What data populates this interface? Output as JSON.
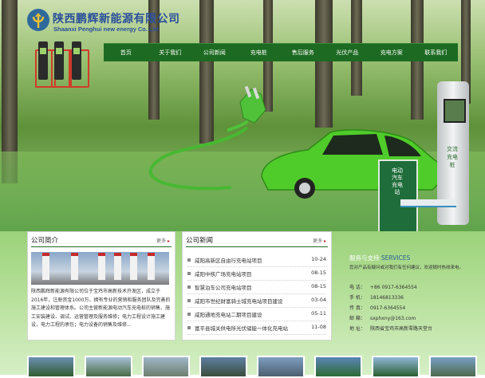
{
  "brand": {
    "name_cn": "陕西鹏辉新能源有限公司",
    "name_en": "Shaanxi Penghui new energy Co. Ltd"
  },
  "nav": {
    "items": [
      "首页",
      "关于我们",
      "公司新闻",
      "充电桩",
      "售后服务",
      "光伏产品",
      "充电方案",
      "联系我们"
    ]
  },
  "hero": {
    "charger_text": "交流充电桩",
    "station_text": "电动汽车充电站"
  },
  "intro": {
    "title": "公司简介",
    "more": "更多",
    "text": "陕西鹏辉新能源有限公司位于宝鸡市高新技术开发区，成立于2016年，注册资金1000万，拥有专业的营销和服务团队及完善的施工建设和管理体系。公司主营新能源电动汽车充电桩的销售、施工安装建设、调试、运营管理及服务维修；电力工程设计施工建设，电力工程的承包；电力设备的销售及维修..."
  },
  "news": {
    "title": "公司新闻",
    "more": "更多",
    "items": [
      {
        "title": "咸阳高新区自由行充电站项目",
        "date": "10-24"
      },
      {
        "title": "咸阳中核广场充电站项目",
        "date": "08-15"
      },
      {
        "title": "智慧泊车公司充电站项目",
        "date": "08-15"
      },
      {
        "title": "咸阳市世纪财富骑士城充电站项目建设",
        "date": "03-04"
      },
      {
        "title": "咸阳通地充电站二期项目建设",
        "date": "05-11"
      },
      {
        "title": "富平县城关供电所光伏储能一体化充电站",
        "date": "11-08"
      }
    ]
  },
  "service": {
    "title_cn": "服务与支持",
    "title_en": "SERVICES",
    "desc": "您对产品有疑问或对我们有任何建议，欢迎随时热线来电。",
    "rows": [
      {
        "k": "电  话：",
        "v": "+86 0917-6364554"
      },
      {
        "k": "手  机：",
        "v": "18146813336"
      },
      {
        "k": "传  真：",
        "v": "0917-6364554"
      },
      {
        "k": "邮  箱：",
        "v": "sxphxny@163.com"
      },
      {
        "k": "地  址：",
        "v": "陕西省宝鸡市高新零路天堂台"
      }
    ]
  },
  "colors": {
    "nav": "#1d6b22",
    "brand": "#2a4f9a",
    "accent_green": "#5fd33a"
  }
}
